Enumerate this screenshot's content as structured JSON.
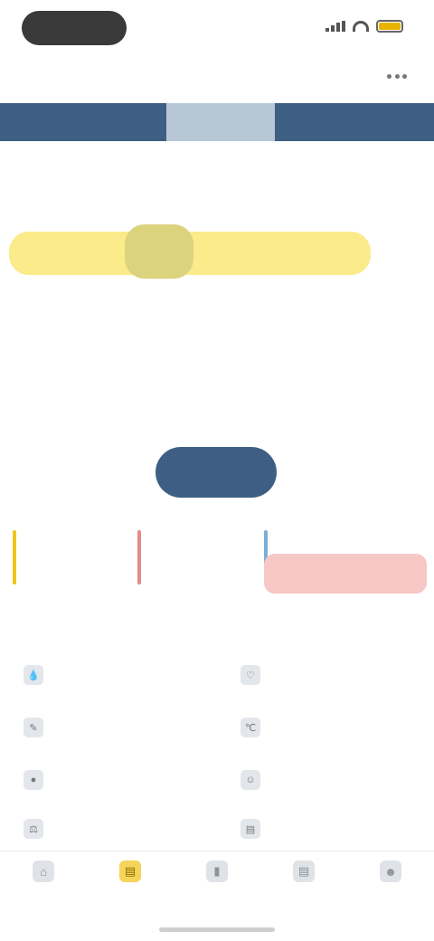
{
  "status_bar": {
    "time": "",
    "battery_color": "#e8b400"
  },
  "header": {
    "title": ""
  },
  "months": [
    "",
    "",
    ""
  ],
  "weekdays": [
    "",
    "",
    "",
    "",
    "",
    "",
    ""
  ],
  "calendar_link": "",
  "weeks": [
    [
      "",
      "",
      "",
      "",
      "",
      "",
      ""
    ],
    [
      "",
      "",
      "",
      "",
      "",
      "",
      ""
    ],
    [
      "",
      "",
      "",
      "",
      "",
      "",
      ""
    ]
  ],
  "record_button": "",
  "legend": [
    {
      "label": "",
      "value": "",
      "color": "#f0c419"
    },
    {
      "label": "",
      "value": "",
      "color": "#e58a86"
    },
    {
      "label": "",
      "value": "",
      "color": "#7aaed4"
    }
  ],
  "legend_alert": "",
  "section": {
    "title": "",
    "edit": ""
  },
  "info_items": [
    {
      "label": "",
      "icon": "drop-icon"
    },
    {
      "label": "",
      "icon": "heart-icon"
    },
    {
      "label": "",
      "icon": "note-icon"
    },
    {
      "label": "",
      "icon": "thermometer-icon"
    },
    {
      "label": "",
      "icon": "pill-icon"
    },
    {
      "label": "",
      "icon": "mood-icon"
    },
    {
      "label": "",
      "icon": "weight-icon"
    },
    {
      "label": "",
      "icon": "calendar-icon"
    }
  ],
  "tabs": [
    {
      "label": "",
      "icon": "home-icon"
    },
    {
      "label": "",
      "icon": "calendar-icon"
    },
    {
      "label": "",
      "icon": "chart-icon"
    },
    {
      "label": "",
      "icon": "book-icon"
    },
    {
      "label": "",
      "icon": "profile-icon"
    }
  ],
  "colors": {
    "accent": "#3e5f83",
    "period": "#fbeb8a",
    "today": "#dcd37f",
    "alert": "#f6c7c4",
    "active_tab": "#f6d45a"
  }
}
